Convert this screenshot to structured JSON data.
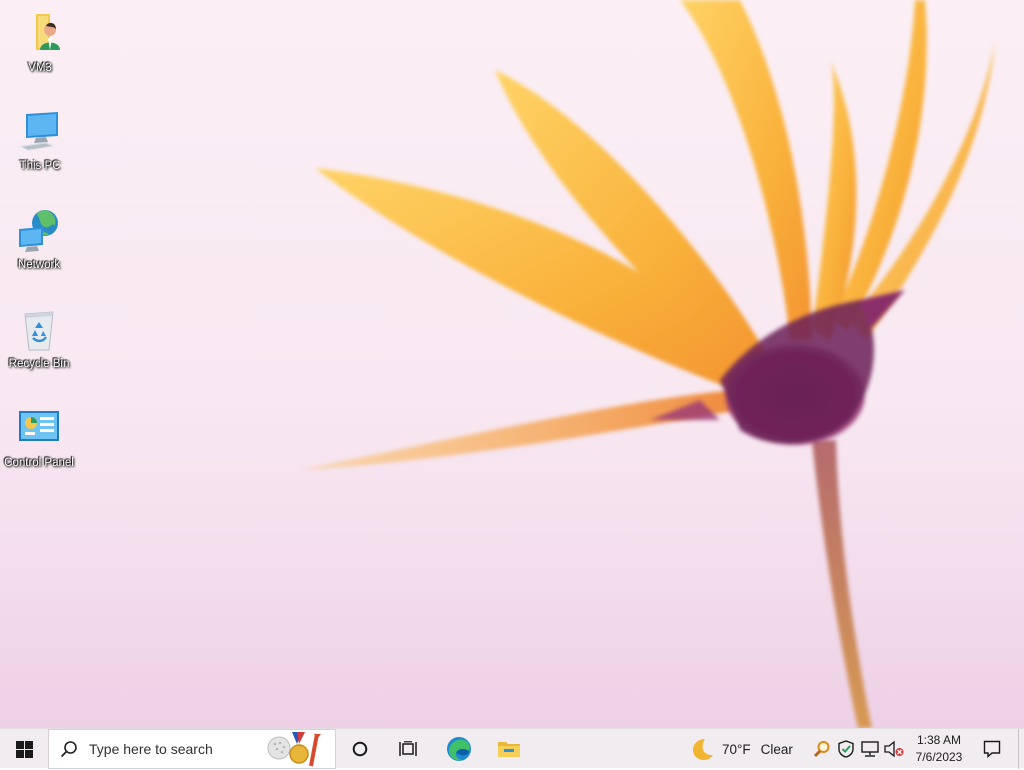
{
  "desktop": {
    "icons": [
      {
        "label": "VM3",
        "icon": "user-folder-icon"
      },
      {
        "label": "This PC",
        "icon": "computer-icon"
      },
      {
        "label": "Network",
        "icon": "network-icon"
      },
      {
        "label": "Recycle Bin",
        "icon": "recycle-bin-icon"
      },
      {
        "label": "Control Panel",
        "icon": "control-panel-icon"
      }
    ]
  },
  "taskbar": {
    "search_placeholder": "Type here to search",
    "weather": {
      "temp": "70°F",
      "condition": "Clear",
      "icon": "moon-icon"
    },
    "clock": {
      "time": "1:38 AM",
      "date": "7/6/2023"
    },
    "tray_icons": [
      "magnifier-icon",
      "security-shield-icon",
      "network-status-icon",
      "volume-muted-icon"
    ],
    "colors": {
      "taskbar": "#f1ecef",
      "edge": "#1e88d2",
      "folder": "#f2c94c"
    }
  }
}
